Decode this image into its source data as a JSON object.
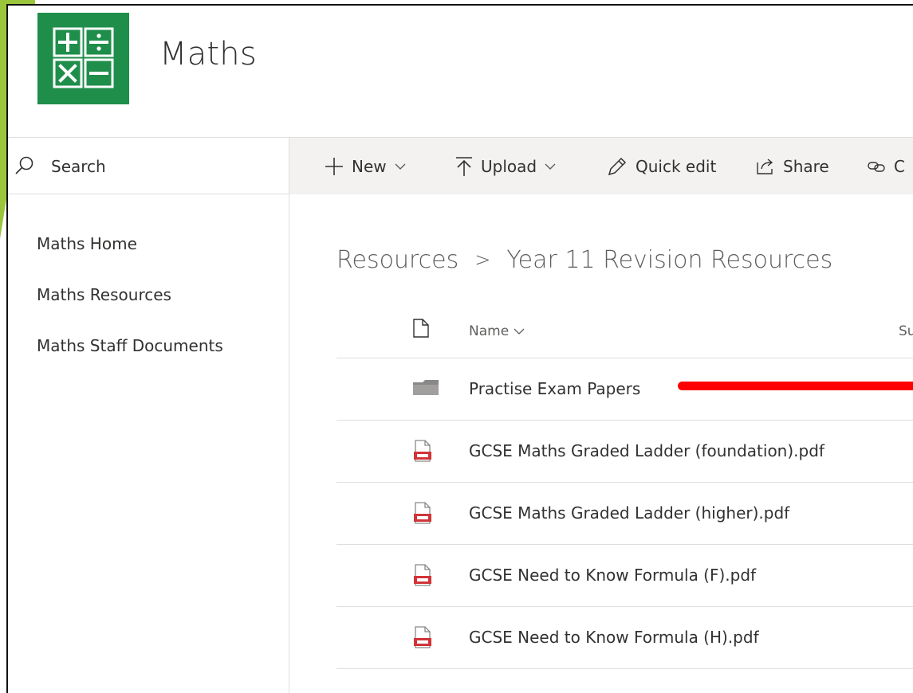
{
  "site": {
    "title": "Maths"
  },
  "search": {
    "label": "Search"
  },
  "nav": {
    "items": [
      {
        "label": "Maths Home"
      },
      {
        "label": "Maths Resources"
      },
      {
        "label": "Maths Staff Documents"
      }
    ]
  },
  "commandbar": {
    "new_label": "New",
    "upload_label": "Upload",
    "quickedit_label": "Quick edit",
    "share_label": "Share",
    "copylink_label": "C"
  },
  "breadcrumb": {
    "parent": "Resources",
    "separator": ">",
    "current": "Year 11 Revision Resources"
  },
  "list": {
    "columns": {
      "name": "Name",
      "second": "Su"
    },
    "rows": [
      {
        "type": "folder",
        "name": "Practise Exam Papers"
      },
      {
        "type": "pdf",
        "name": "GCSE Maths Graded Ladder (foundation).pdf"
      },
      {
        "type": "pdf",
        "name": "GCSE Maths Graded Ladder (higher).pdf"
      },
      {
        "type": "pdf",
        "name": "GCSE Need to Know Formula (F).pdf"
      },
      {
        "type": "pdf",
        "name": "GCSE Need to Know Formula (H).pdf"
      }
    ]
  },
  "colors": {
    "brand_green": "#1f8e4b",
    "deco_green": "#9bc63b",
    "annotation_red": "#ff0000",
    "pdf_red": "#d13438"
  }
}
